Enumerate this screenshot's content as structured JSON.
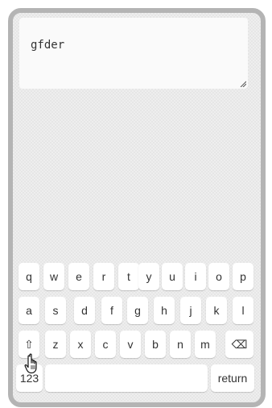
{
  "text_area": {
    "value": "gfder"
  },
  "keyboard": {
    "row1": [
      "q",
      "w",
      "e",
      "r",
      "t",
      "y",
      "u",
      "i",
      "o",
      "p"
    ],
    "row2": [
      "a",
      "s",
      "d",
      "f",
      "g",
      "h",
      "j",
      "k",
      "l"
    ],
    "row3": [
      "z",
      "x",
      "c",
      "v",
      "b",
      "n",
      "m"
    ],
    "shift_label": "⇧",
    "backspace_label": "⌫",
    "numbers_label": "123",
    "return_label": "return"
  },
  "icons": {
    "cursor": "hand-pointer-icon",
    "resize": "resize-grip-icon"
  }
}
